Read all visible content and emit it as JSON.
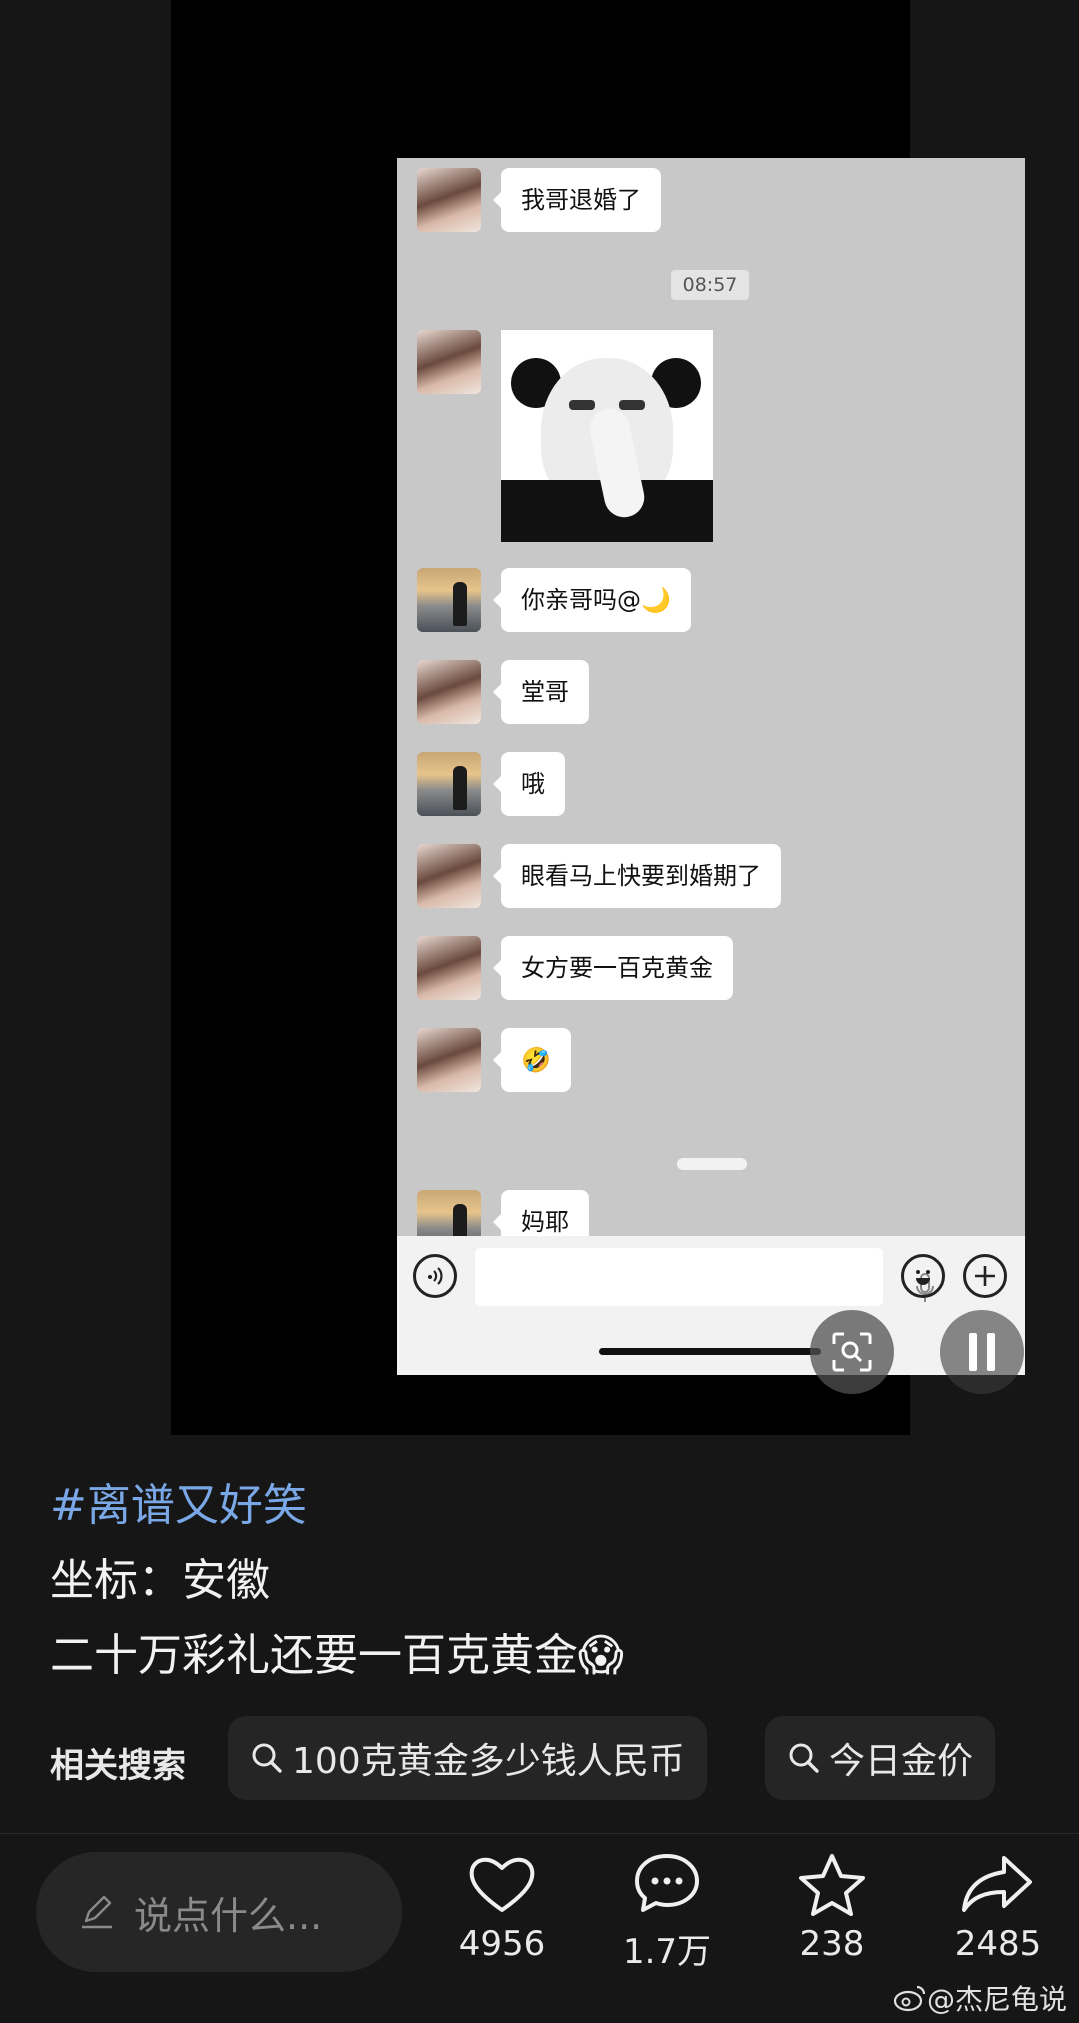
{
  "chat": {
    "timestamp": "08:57",
    "messages": [
      {
        "sender": "girl",
        "text": "我哥退婚了"
      },
      {
        "sender": "girl",
        "type": "sticker",
        "sticker": "panda-meme-sticker"
      },
      {
        "sender": "man",
        "text": "你亲哥吗@🌙"
      },
      {
        "sender": "girl",
        "text": "堂哥"
      },
      {
        "sender": "man",
        "text": "哦"
      },
      {
        "sender": "girl",
        "text": "眼看马上快要到婚期了"
      },
      {
        "sender": "girl",
        "text": "女方要一百克黄金"
      },
      {
        "sender": "girl",
        "text": "🤣"
      },
      {
        "sender": "man",
        "text": "妈耶"
      }
    ]
  },
  "post": {
    "hashtag": "#离谱又好笑",
    "location_line": "坐标：安徽",
    "body_line": "二十万彩礼还要一百克黄金😱"
  },
  "related": {
    "label": "相关搜索",
    "chips": [
      "100克黄金多少钱人民币",
      "今日金价"
    ]
  },
  "actions": {
    "comment_placeholder": "说点什么...",
    "likes": "4956",
    "comments": "1.7万",
    "favorites": "238",
    "shares": "2485"
  },
  "watermark": "@杰尼龟说",
  "colors": {
    "background": "#161616",
    "hashtag": "#7aa7e6",
    "chat_background": "#c8c8c8"
  }
}
